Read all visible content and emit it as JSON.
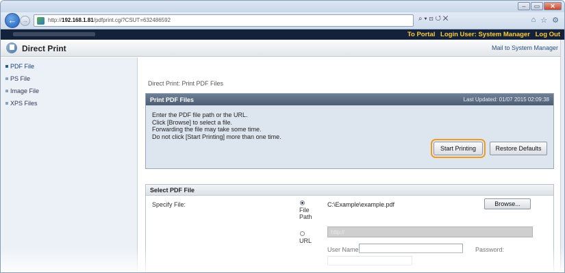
{
  "browser": {
    "url_host": "192.168.1.81",
    "url_prefix": "http://",
    "url_path": "/pdfprint.cgi?CSUT=632486592",
    "search_icons": "⌕ ▾ ⊡ ↺ ✕",
    "window_buttons": {
      "minimize": "–",
      "restore": "▭",
      "close": "✕"
    },
    "nav_back": "←",
    "nav_forward": "→",
    "chrome_icons": {
      "home": "⌂",
      "favorites": "☆",
      "settings": "⚙"
    }
  },
  "header": {
    "portal_link": "To Portal",
    "login_user": "Login User: System Manager",
    "logout_link": "Log Out"
  },
  "title": {
    "heading": "Direct Print",
    "mail_link": "Mail to System Manager"
  },
  "sidebar": {
    "items": [
      {
        "label": "PDF File",
        "active": true
      },
      {
        "label": "PS File",
        "active": false
      },
      {
        "label": "Image File",
        "active": false
      },
      {
        "label": "XPS Files",
        "active": false
      }
    ]
  },
  "main": {
    "breadcrumb": "Direct Print: Print PDF Files",
    "panel": {
      "title": "Print PDF Files",
      "updated": "Last Updated: 01/07 2015 02:09:38",
      "instructions": [
        "Enter the PDF file path or the URL.",
        "Click [Browse] to select a file.",
        "Forwarding the file may take some time.",
        "Do not click [Start Printing] more than one time."
      ],
      "start_button": "Start Printing",
      "restore_button": "Restore Defaults"
    },
    "select": {
      "title": "Select PDF File",
      "specify_label": "Specify File:",
      "file_path_label_1": "File",
      "file_path_label_2": "Path",
      "file_path_value": "C:\\Example\\example.pdf",
      "browse_button": "Browse...",
      "url_label": "URL",
      "url_value": "http://",
      "username_label": "User Name:",
      "password_label": "Password:",
      "file_path_selected": true
    }
  },
  "colors": {
    "header_bg": "#14213a",
    "header_link": "#ffcc33",
    "highlight_outline": "#f39a1a",
    "panel_head": "#5d6d84"
  }
}
